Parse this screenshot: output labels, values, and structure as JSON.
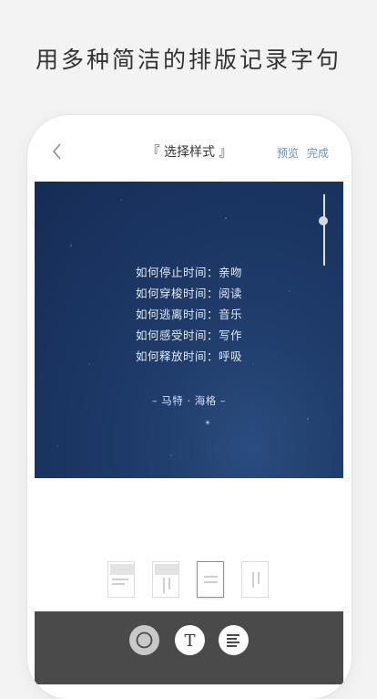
{
  "headline": "用多种简洁的排版记录字句",
  "nav": {
    "title": "『 选择样式 』",
    "preview_label": "预览",
    "done_label": "完成"
  },
  "canvas": {
    "poem_lines": [
      "如何停止时间：亲吻",
      "如何穿梭时间：阅读",
      "如何逃离时间：音乐",
      "如何感受时间：写作",
      "如何释放时间：呼吸"
    ],
    "author": "– 马特 · 海格 –",
    "background_color": "#1b355f"
  },
  "layout_options": {
    "selected_index": 2
  },
  "toolbar": {
    "text_tool_glyph": "T",
    "icons": [
      "circle-shape-icon",
      "text-icon",
      "align-left-icon"
    ]
  },
  "colors": {
    "accent": "#6f8fb2",
    "toolbar_bg": "#4a4a4a"
  }
}
